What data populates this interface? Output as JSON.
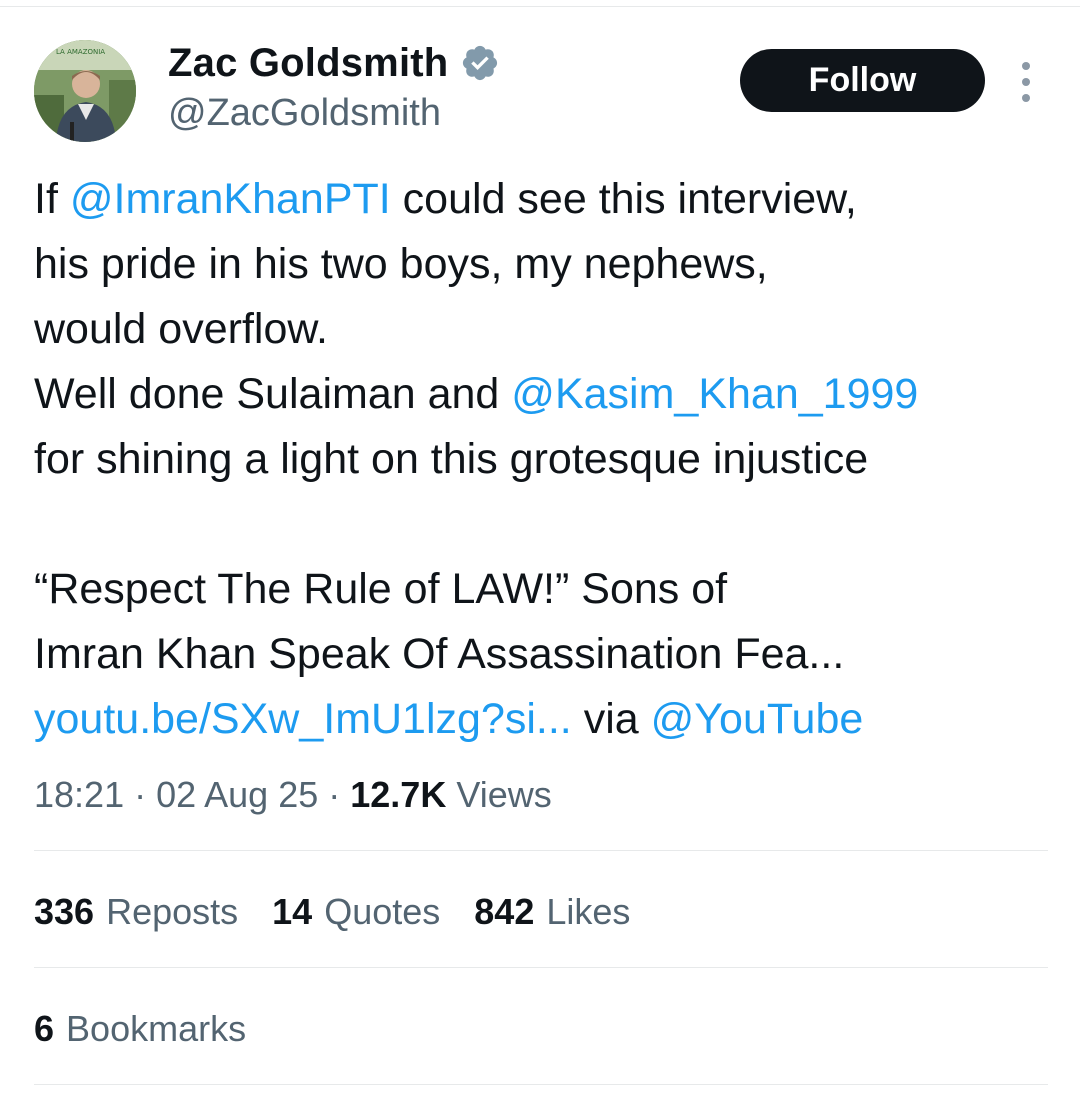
{
  "author": {
    "display_name": "Zac Goldsmith",
    "handle": "@ZacGoldsmith",
    "verified": true,
    "avatar_caption": "LA AMAZONIA"
  },
  "actions": {
    "follow_label": "Follow"
  },
  "tweet": {
    "l1_pre": "If ",
    "l1_mention": "@ImranKhanPTI",
    "l1_post": " could see this interview,",
    "l2": "his pride in his two boys, my nephews,",
    "l3": "would overflow.",
    "l4_pre": "Well done Sulaiman and ",
    "l4_mention": "@Kasim_Khan_1999",
    "l5": "for shining a light on this grotesque injustice",
    "l6": "“Respect The Rule of LAW!” Sons of",
    "l7": "Imran Khan Speak Of Assassination Fea...",
    "l8_link": "youtu.be/SXw_ImU1lzg?si...",
    "l8_mid": " via ",
    "l8_mention": "@YouTube"
  },
  "meta": {
    "time": "18:21",
    "separator": " · ",
    "date": "02 Aug 25",
    "views_count": "12.7K",
    "views_label": " Views"
  },
  "stats": {
    "reposts_count": "336",
    "reposts_label": "Reposts",
    "quotes_count": "14",
    "quotes_label": "Quotes",
    "likes_count": "842",
    "likes_label": "Likes",
    "bookmarks_count": "6",
    "bookmarks_label": "Bookmarks"
  },
  "colors": {
    "link": "#1d9bf0",
    "text": "#0f1419",
    "secondary": "#536471",
    "verified_badge": "#829aab",
    "follow_bg": "#0f1419"
  },
  "icons": {
    "verified": "verified-badge-icon",
    "more": "more-options-icon"
  }
}
